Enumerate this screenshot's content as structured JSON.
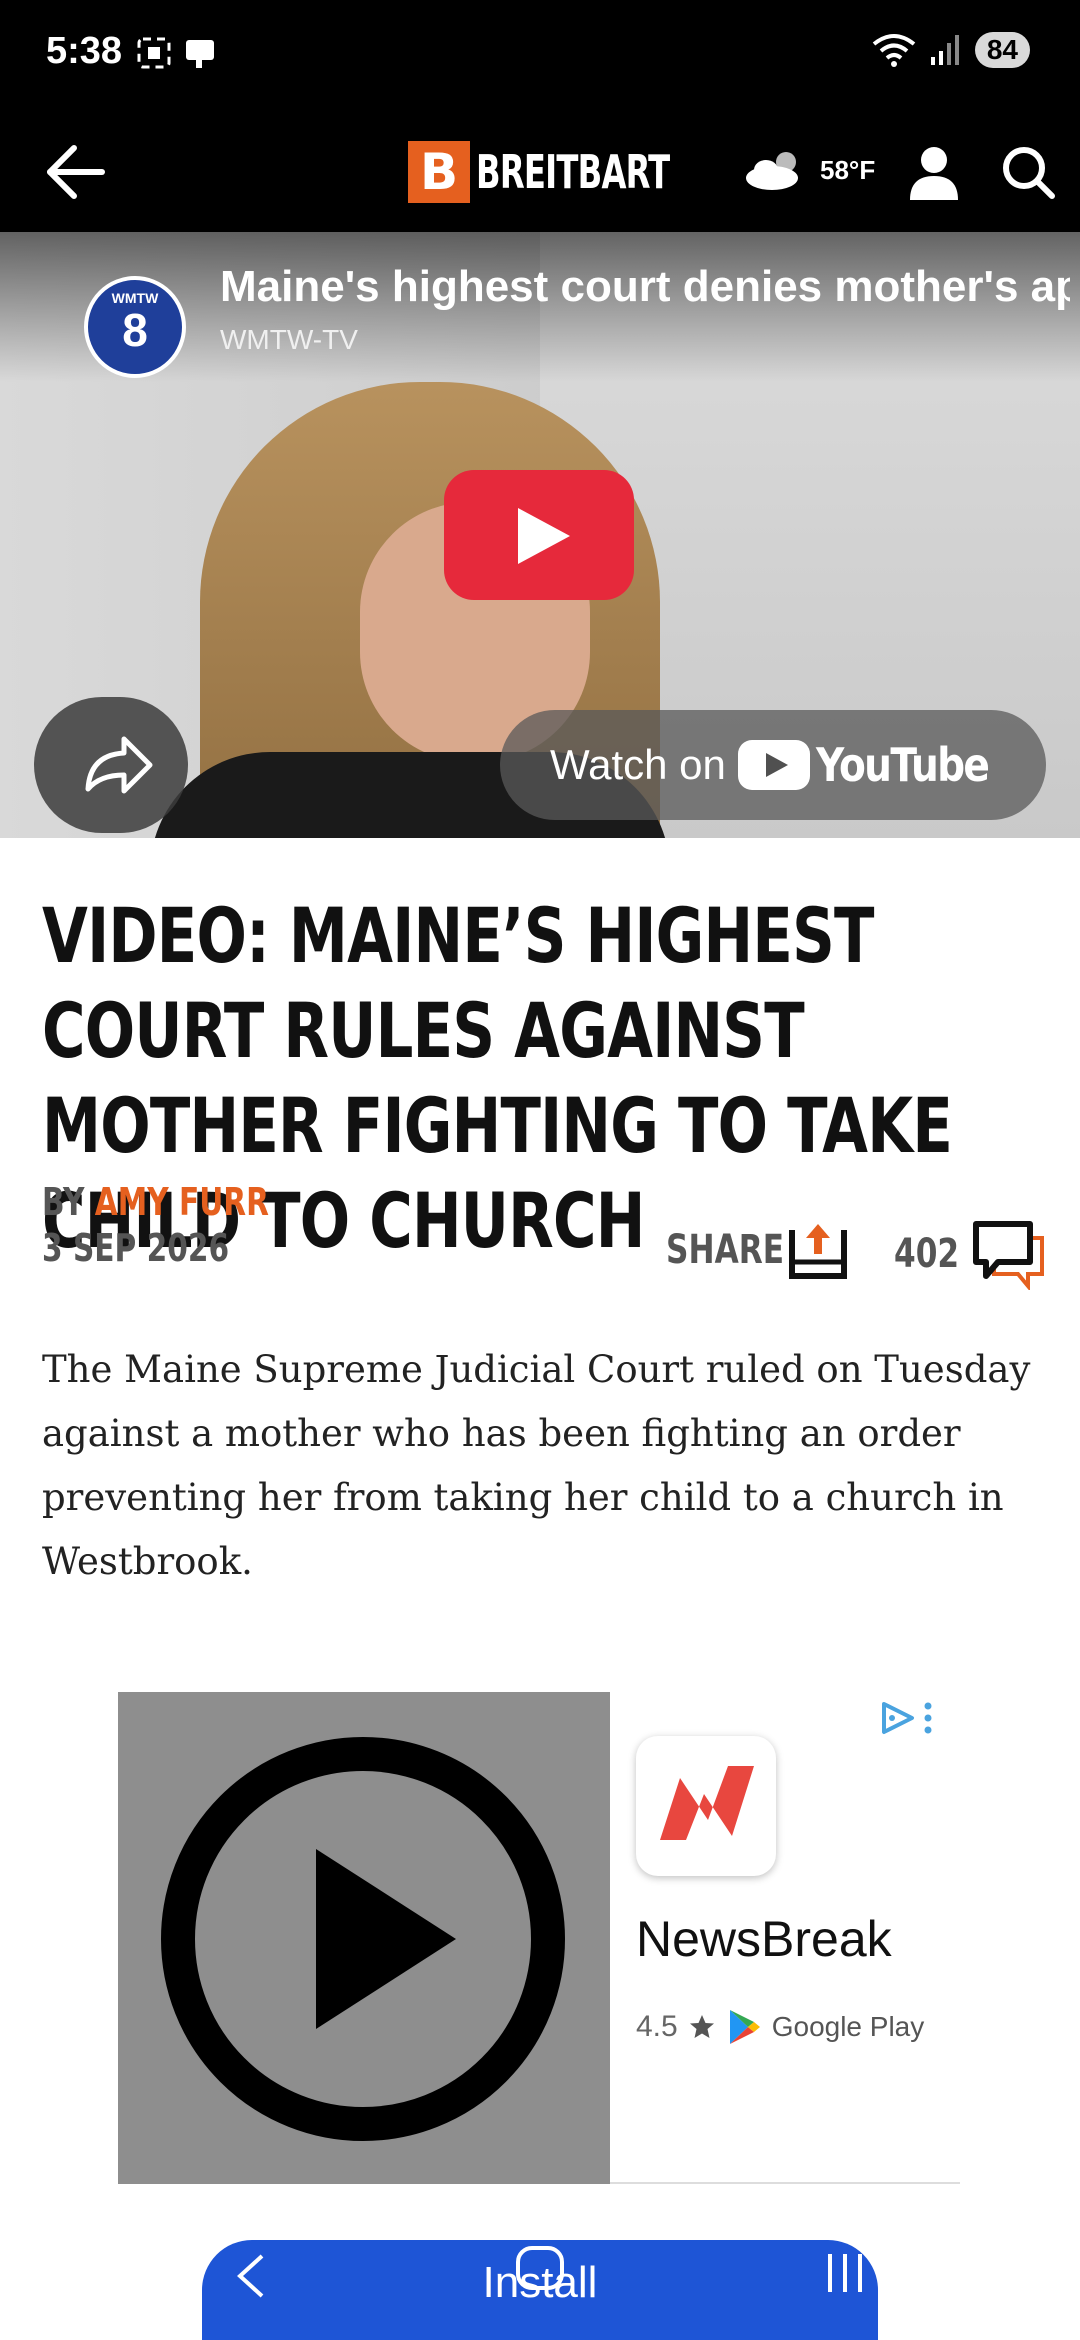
{
  "status_bar": {
    "time": "5:38",
    "battery": "84",
    "network": "6"
  },
  "header": {
    "logo_letter": "B",
    "logo_text": "BREITBART",
    "weather_temp": "58°F",
    "brand_color": "#e5601f"
  },
  "video": {
    "title": "Maine's highest court denies mother's ap",
    "channel": "WMTW-TV",
    "channel_badge_top": "WMTW",
    "channel_badge_num": "8",
    "watch_on": "Watch on",
    "youtube_word": "YouTube"
  },
  "article": {
    "headline": "VIDEO: Maine’s Highest Court Rules Against Mother Fighting to Take Child to Church",
    "by_prefix": "BY",
    "author": "AMY FURR",
    "date": "3 SEP 2026",
    "share_label": "SHARE",
    "comment_count": "402",
    "body": "The Maine Supreme Judicial Court ruled on Tuesday against a mother who has been fighting an order preventing her from taking her child to a church in Westbrook."
  },
  "ad": {
    "app_name": "NewsBreak",
    "rating": "4.5",
    "store": "Google Play",
    "install_label": "Install"
  }
}
